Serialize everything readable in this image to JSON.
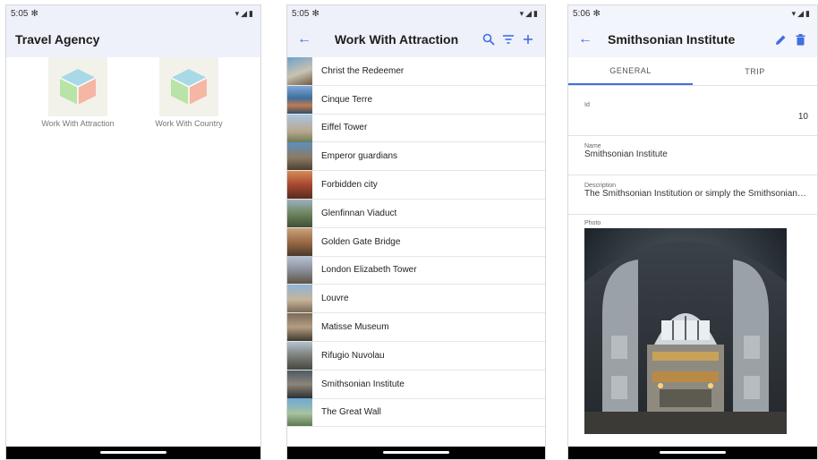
{
  "status": {
    "screen1_time": "5:05",
    "screen2_time": "5:05",
    "screen3_time": "5:06"
  },
  "icons": {
    "settings": "gear-icon",
    "wifi": "wifi-icon",
    "signal": "signal-icon",
    "battery": "battery-icon",
    "back": "arrow-left-icon",
    "search": "search-icon",
    "filter": "filter-icon",
    "add": "plus-icon",
    "edit": "pencil-icon",
    "delete": "trash-icon"
  },
  "colors": {
    "accent": "#3f6fe3",
    "header_bg": "#eef0fa",
    "nav_bar": "#000000"
  },
  "home": {
    "title": "Travel Agency",
    "tiles": [
      {
        "label": "Work With Attraction"
      },
      {
        "label": "Work With Country"
      }
    ]
  },
  "attractions": {
    "title": "Work With Attraction",
    "items": [
      {
        "name": "Christ the Redeemer"
      },
      {
        "name": "Cinque Terre"
      },
      {
        "name": "Eiffel Tower"
      },
      {
        "name": "Emperor guardians"
      },
      {
        "name": "Forbidden city"
      },
      {
        "name": "Glenfinnan Viaduct"
      },
      {
        "name": "Golden Gate Bridge"
      },
      {
        "name": "London Elizabeth Tower"
      },
      {
        "name": "Louvre"
      },
      {
        "name": "Matisse Museum"
      },
      {
        "name": "Rifugio Nuvolau"
      },
      {
        "name": "Smithsonian Institute"
      },
      {
        "name": "The Great Wall"
      }
    ]
  },
  "detail": {
    "title": "Smithsonian Institute",
    "tabs": {
      "general": "GENERAL",
      "trip": "TRIP"
    },
    "fields": {
      "id_label": "Id",
      "id_value": "10",
      "name_label": "Name",
      "name_value": "Smithsonian Institute",
      "description_label": "Description",
      "description_value": "The Smithsonian Institution or simply the Smithsonian, is a group of museums and education and research centers",
      "photo_label": "Photo"
    }
  }
}
